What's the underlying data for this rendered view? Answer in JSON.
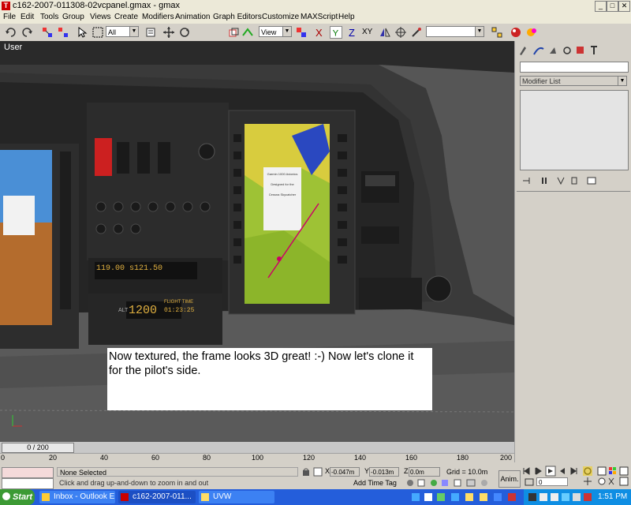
{
  "window": {
    "title": "c162-2007-011308-02vcpanel.gmax - gmax",
    "min": "_",
    "max": "□",
    "close": "✕"
  },
  "menu": [
    "File",
    "Edit",
    "Tools",
    "Group",
    "Views",
    "Create",
    "Modifiers",
    "Animation",
    "Graph Editors",
    "Customize",
    "MAXScript",
    "Help"
  ],
  "toolbar": {
    "selection_filter": "All",
    "ref_coord": "View",
    "axis_x": "X",
    "axis_y": "Y",
    "axis_z": "Z",
    "axis_xy": "XY"
  },
  "viewport": {
    "label": "User",
    "panel": {
      "label_mhz": "119.00  s121.50",
      "xpdr": "1200",
      "alt": "ALT",
      "flight_time": "FLIGHT TIME",
      "time_val": "01:23:25",
      "gps_text1": "Garmin 1000 Avionics",
      "gps_text2": "Designed for the",
      "gps_text3": "Cessna Skycatcher"
    }
  },
  "caption": {
    "text": "Now textured, the frame looks 3D great!  :-)  Now let's clone it for the pilot's side."
  },
  "cmdpanel": {
    "modifier_list": "Modifier List"
  },
  "timeline": {
    "frame": "0 / 200",
    "ticks": [
      "0",
      "20",
      "40",
      "60",
      "80",
      "100",
      "120",
      "140",
      "160",
      "180",
      "200"
    ]
  },
  "status": {
    "selection": "None Selected",
    "prompt": "Click and drag up-and-down to zoom in and out",
    "x_label": "X",
    "x_val": "-0.047m",
    "y_label": "Y",
    "y_val": "-0.013m",
    "z_label": "Z",
    "z_val": "0.0m",
    "grid": "Grid = 10.0m",
    "add_time_tag": "Add Time Tag",
    "anim": "Anim.",
    "frame_field": "0"
  },
  "taskbar": {
    "start": "Start",
    "tasks": [
      "Inbox - Outlook E...",
      "c162-2007-011...",
      "UVW"
    ],
    "clock": "1:51 PM"
  },
  "colors": {
    "viewport_bg": "#5c5c5c",
    "taskbar": "#245edb",
    "start_green": "#3c9a34"
  }
}
